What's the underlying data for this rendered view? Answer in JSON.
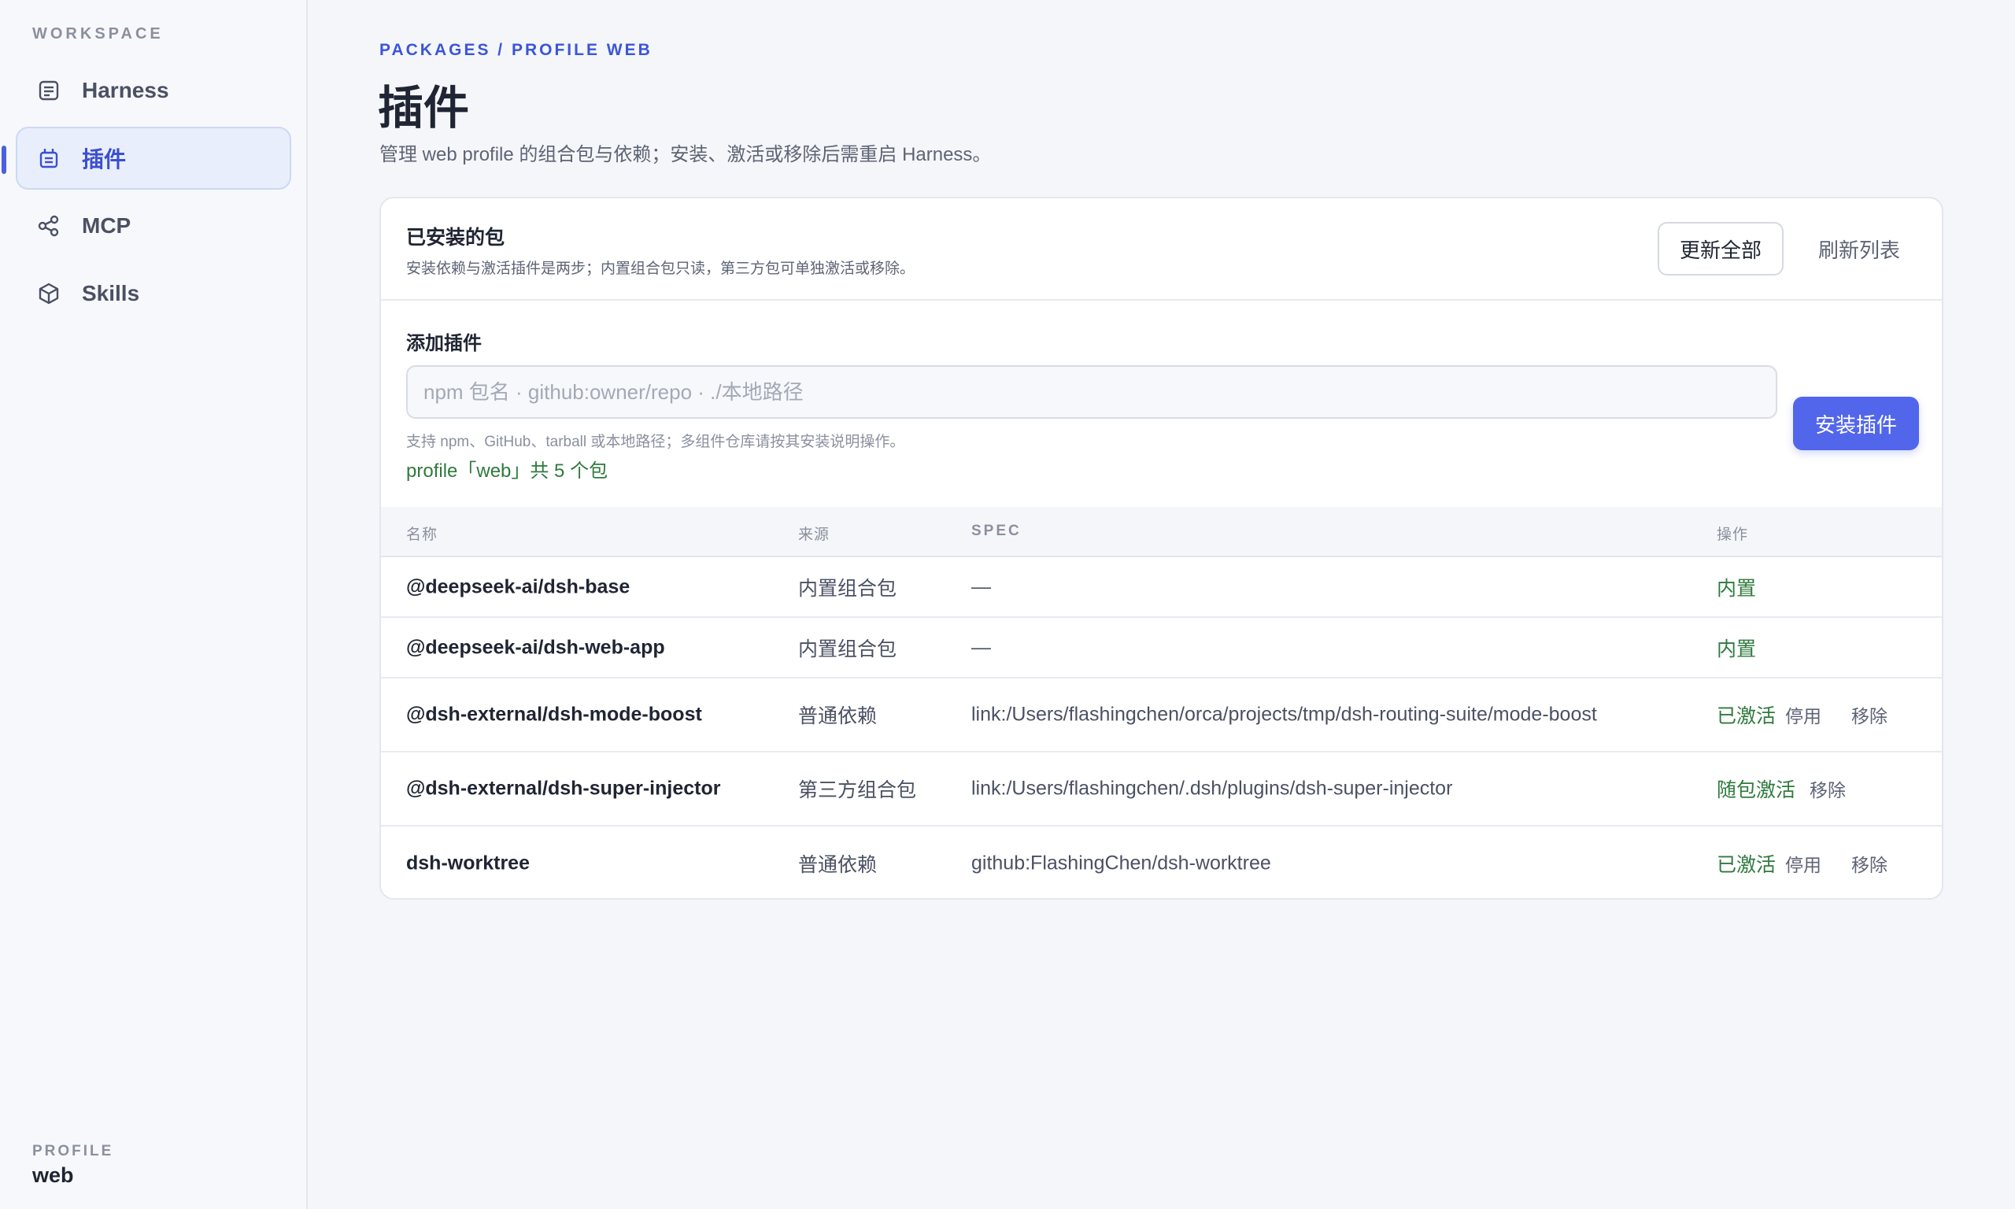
{
  "sidebar": {
    "section_label": "WORKSPACE",
    "items": [
      {
        "label": "Harness",
        "icon": "document-list-icon",
        "active": false
      },
      {
        "label": "插件",
        "icon": "plugin-icon",
        "active": true
      },
      {
        "label": "MCP",
        "icon": "share-nodes-icon",
        "active": false
      },
      {
        "label": "Skills",
        "icon": "cube-icon",
        "active": false
      }
    ],
    "profile_label": "PROFILE",
    "profile_value": "web"
  },
  "header": {
    "breadcrumb": "PACKAGES / PROFILE WEB",
    "title": "插件",
    "subtitle": "管理 web profile 的组合包与依赖；安装、激活或移除后需重启 Harness。"
  },
  "installed": {
    "title": "已安装的包",
    "description": "安装依赖与激活插件是两步；内置组合包只读，第三方包可单独激活或移除。",
    "update_all_label": "更新全部",
    "refresh_label": "刷新列表"
  },
  "add_plugin": {
    "label": "添加插件",
    "placeholder": "npm 包名 · github:owner/repo · ./本地路径",
    "value": "",
    "install_label": "安装插件",
    "hint": "支持 npm、GitHub、tarball 或本地路径；多组件仓库请按其安装说明操作。",
    "count_text": "profile「web」共 5 个包"
  },
  "table": {
    "columns": [
      "名称",
      "来源",
      "SPEC",
      "操作"
    ],
    "rows": [
      {
        "name": "@deepseek-ai/dsh-base",
        "source": "内置组合包",
        "spec": "—",
        "state": "内置",
        "actions": []
      },
      {
        "name": "@deepseek-ai/dsh-web-app",
        "source": "内置组合包",
        "spec": "—",
        "state": "内置",
        "actions": []
      },
      {
        "name": "@dsh-external/dsh-mode-boost",
        "source": "普通依赖",
        "spec": "link:/Users/flashingchen/orca/projects/tmp/dsh-routing-suite/mode-boost",
        "state": "已激活",
        "actions": [
          "停用",
          "移除"
        ]
      },
      {
        "name": "@dsh-external/dsh-super-injector",
        "source": "第三方组合包",
        "spec": "link:/Users/flashingchen/.dsh/plugins/dsh-super-injector",
        "state": "随包激活",
        "actions": [
          "移除"
        ]
      },
      {
        "name": "dsh-worktree",
        "source": "普通依赖",
        "spec": "github:FlashingChen/dsh-worktree",
        "state": "已激活",
        "actions": [
          "停用",
          "移除"
        ]
      }
    ]
  },
  "colors": {
    "accent": "#5266ec",
    "active_text": "#3b4fcf",
    "success": "#2f7a3d",
    "background": "#f5f6f9"
  }
}
